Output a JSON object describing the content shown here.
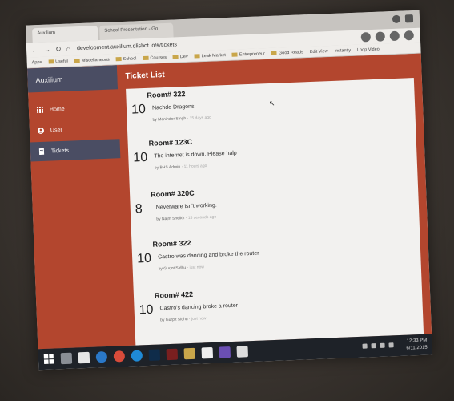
{
  "browser": {
    "tabs": [
      "Auxilium",
      "School Presentation - Go"
    ],
    "address": "development.auxilium.dlishot.io/#/tickets",
    "bookmarks": [
      "Apps",
      "Useful",
      "Miscellaneous",
      "School",
      "Courses",
      "Dev",
      "Leak Market",
      "Entrepreneur",
      "Good Reads"
    ],
    "right_links": [
      "Edit View",
      "Instantly",
      "Loop Video"
    ]
  },
  "app": {
    "brand": "Auxilium",
    "header_title": "Ticket List",
    "nav": [
      {
        "label": "Home",
        "icon": "grid-icon"
      },
      {
        "label": "User",
        "icon": "user-icon"
      },
      {
        "label": "Tickets",
        "icon": "ticket-icon"
      }
    ]
  },
  "tickets": [
    {
      "room": "Room# 322",
      "count": "10",
      "desc": "Nachde Dragons",
      "by": "Maninder Singh",
      "ago": "15 days ago"
    },
    {
      "room": "Room# 123C",
      "count": "10",
      "desc": "The internet is down. Please halp",
      "by": "BHS Admin",
      "ago": "11 hours ago"
    },
    {
      "room": "Room# 320C",
      "count": "8",
      "desc": "Neverware isn't working.",
      "by": "Najm Sheikh",
      "ago": "15 seconds ago"
    },
    {
      "room": "Room# 322",
      "count": "10",
      "desc": "Castro was dancing and broke the router",
      "by": "Gurjot Sidhu",
      "ago": "just now"
    },
    {
      "room": "Room# 422",
      "count": "10",
      "desc": "Castro's dancing broke a router",
      "by": "Gurpit Sidhu",
      "ago": "just now"
    }
  ],
  "taskbar": {
    "time": "12:33 PM",
    "date": "6/11/2015"
  }
}
